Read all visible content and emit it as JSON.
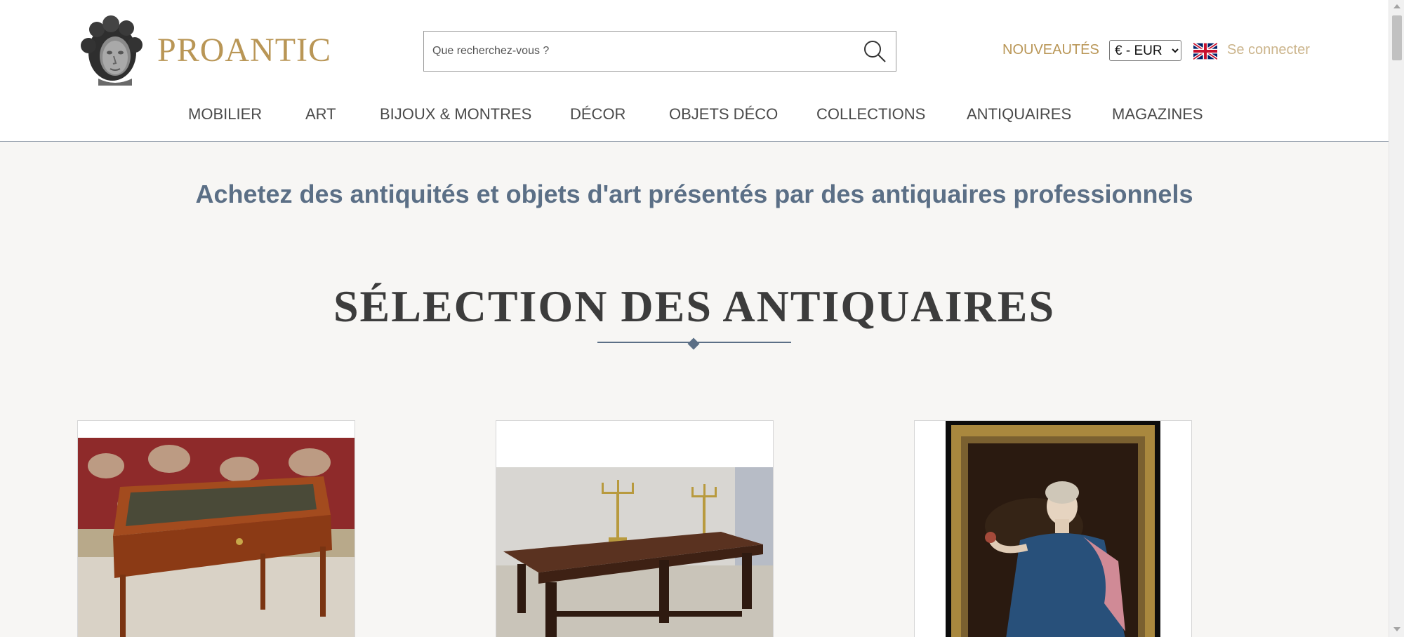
{
  "header": {
    "logo_text": "PROANTIC",
    "search_placeholder": "Que recherchez-vous ?",
    "new_link": "NOUVEAUTÉS",
    "currency": "€ - EUR",
    "currency_options": [
      "€ - EUR"
    ],
    "language_icon": "uk-flag-icon",
    "login_link": "Se connecter"
  },
  "nav": {
    "items": [
      "MOBILIER",
      "ART",
      "BIJOUX & MONTRES",
      "DÉCOR",
      "OBJETS DÉCO",
      "COLLECTIONS",
      "ANTIQUAIRES",
      "MAGAZINES"
    ]
  },
  "hero": {
    "tagline": "Achetez des antiquités et objets d'art présentés par des antiquaires professionnels",
    "section_title": "SÉLECTION DES ANTIQUAIRES"
  },
  "colors": {
    "brand_gold": "#b99656",
    "accent_blue": "#5b6f86",
    "background": "#f7f6f4"
  }
}
